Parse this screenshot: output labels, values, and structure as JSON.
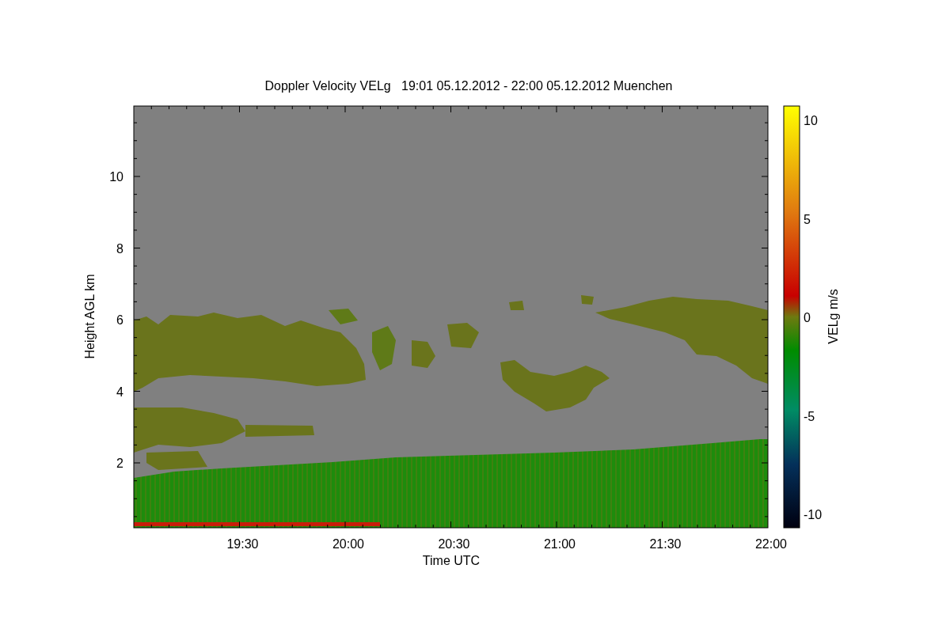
{
  "plot": {
    "title": "Doppler Velocity VELg   19:01 05.12.2012 - 22:00 05.12.2012 Muenchen",
    "xlabel": "Time UTC",
    "ylabel": "Height AGL km",
    "xticks": [
      "19:30",
      "20:00",
      "20:30",
      "21:00",
      "21:30",
      "22:00"
    ],
    "yticks": [
      "10",
      "8",
      "6",
      "4",
      "2"
    ],
    "colorbar": {
      "label": "VELg m/s",
      "ticks": [
        "10",
        "5",
        "0",
        "-5",
        "-10"
      ]
    }
  }
}
